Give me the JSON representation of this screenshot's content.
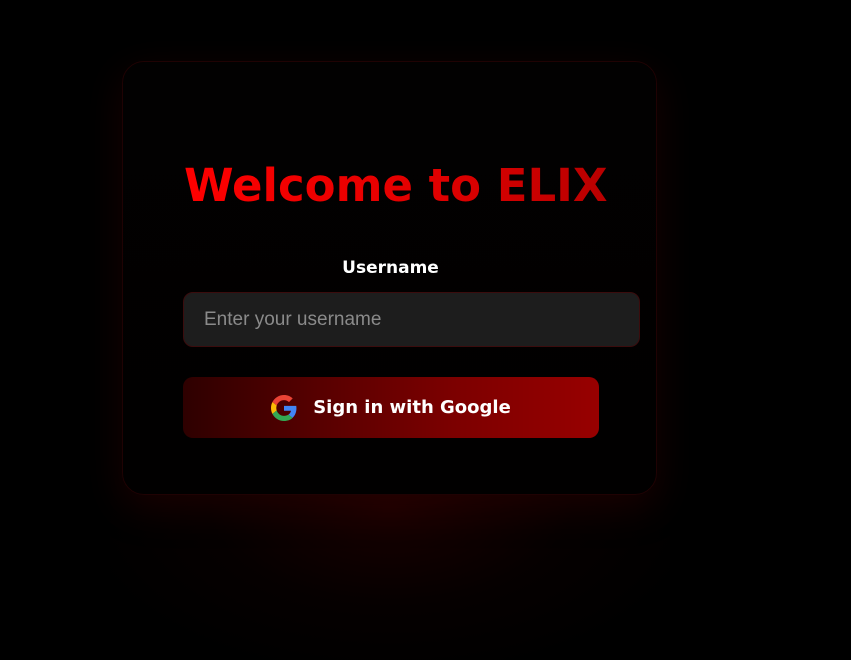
{
  "login": {
    "title": "Welcome to ELIX",
    "username_label": "Username",
    "username_placeholder": "Enter your username",
    "username_value": "",
    "google_button_label": "Sign in with Google",
    "google_icon": "google-g-logo"
  },
  "colors": {
    "background": "#000000",
    "title_accent": "#ff0000",
    "button_gradient_start": "#2e0000",
    "button_gradient_end": "#980000",
    "input_background": "#1d1d1d",
    "card_border": "#1f0203"
  }
}
